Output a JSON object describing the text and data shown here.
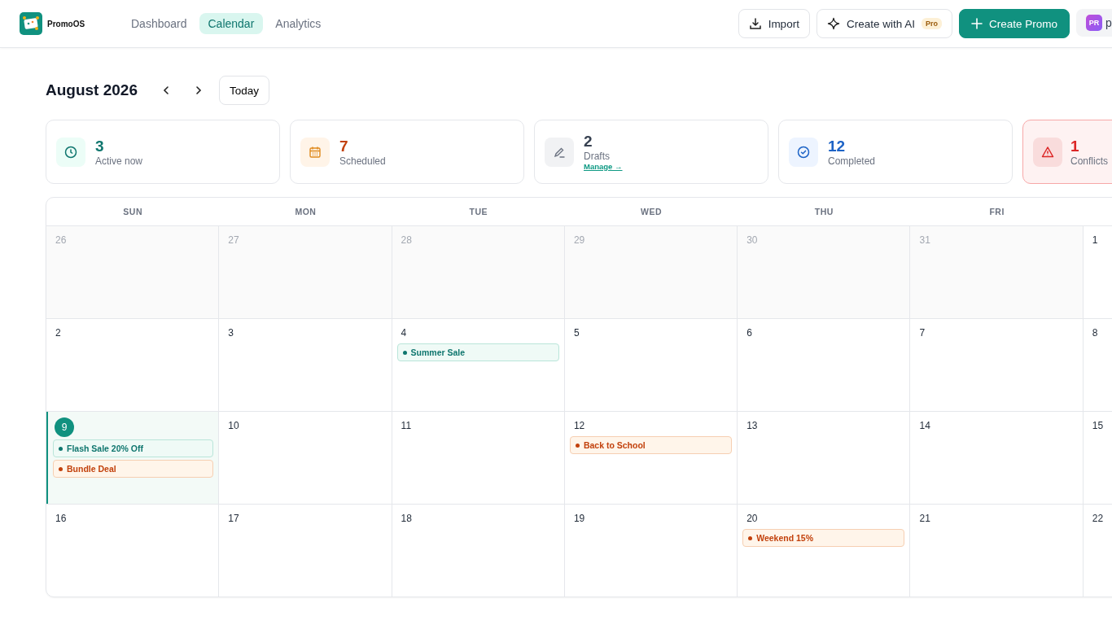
{
  "app": {
    "name": "PromoOS"
  },
  "nav": [
    {
      "label": "Dashboard",
      "selected": false
    },
    {
      "label": "Calendar",
      "selected": true
    },
    {
      "label": "Analytics",
      "selected": false
    }
  ],
  "actions": {
    "import": "Import",
    "ai": "Create with AI",
    "ai_badge": "Pro",
    "create": "Create Promo",
    "avatar": "PR",
    "user": "p"
  },
  "month": "August 2026",
  "today_button": "Today",
  "stats": [
    {
      "kind": "active",
      "value": "3",
      "label": "Active now"
    },
    {
      "kind": "scheduled",
      "value": "7",
      "label": "Scheduled"
    },
    {
      "kind": "drafts",
      "value": "2",
      "label": "Drafts",
      "link": "Manage →"
    },
    {
      "kind": "completed",
      "value": "12",
      "label": "Completed"
    },
    {
      "kind": "conflicts",
      "value": "1",
      "label": "Conflicts"
    }
  ],
  "weekdays": [
    "SUN",
    "MON",
    "TUE",
    "WED",
    "THU",
    "FRI"
  ],
  "weeks": [
    [
      {
        "day": "26",
        "muted": true
      },
      {
        "day": "27",
        "muted": true
      },
      {
        "day": "28",
        "muted": true
      },
      {
        "day": "29",
        "muted": true
      },
      {
        "day": "30",
        "muted": true
      },
      {
        "day": "31",
        "muted": true
      },
      {
        "day": "1",
        "muted": false
      }
    ],
    [
      {
        "day": "2",
        "muted": false
      },
      {
        "day": "3",
        "muted": false
      },
      {
        "day": "4",
        "muted": false,
        "events": [
          {
            "title": "Summer Sale",
            "kind": "active"
          }
        ]
      },
      {
        "day": "5",
        "muted": false
      },
      {
        "day": "6",
        "muted": false
      },
      {
        "day": "7",
        "muted": false
      },
      {
        "day": "8",
        "muted": false
      }
    ],
    [
      {
        "day": "9",
        "muted": false,
        "today": true,
        "events": [
          {
            "title": "Flash Sale 20% Off",
            "kind": "active"
          },
          {
            "title": "Bundle Deal",
            "kind": "scheduled"
          }
        ]
      },
      {
        "day": "10",
        "muted": false
      },
      {
        "day": "11",
        "muted": false
      },
      {
        "day": "12",
        "muted": false,
        "events": [
          {
            "title": "Back to School",
            "kind": "scheduled"
          }
        ]
      },
      {
        "day": "13",
        "muted": false
      },
      {
        "day": "14",
        "muted": false
      },
      {
        "day": "15",
        "muted": false
      }
    ],
    [
      {
        "day": "16",
        "muted": false
      },
      {
        "day": "17",
        "muted": false
      },
      {
        "day": "18",
        "muted": false
      },
      {
        "day": "19",
        "muted": false
      },
      {
        "day": "20",
        "muted": false,
        "events": [
          {
            "title": "Weekend 15%",
            "kind": "scheduled"
          }
        ]
      },
      {
        "day": "21",
        "muted": false
      },
      {
        "day": "22",
        "muted": false
      }
    ]
  ]
}
